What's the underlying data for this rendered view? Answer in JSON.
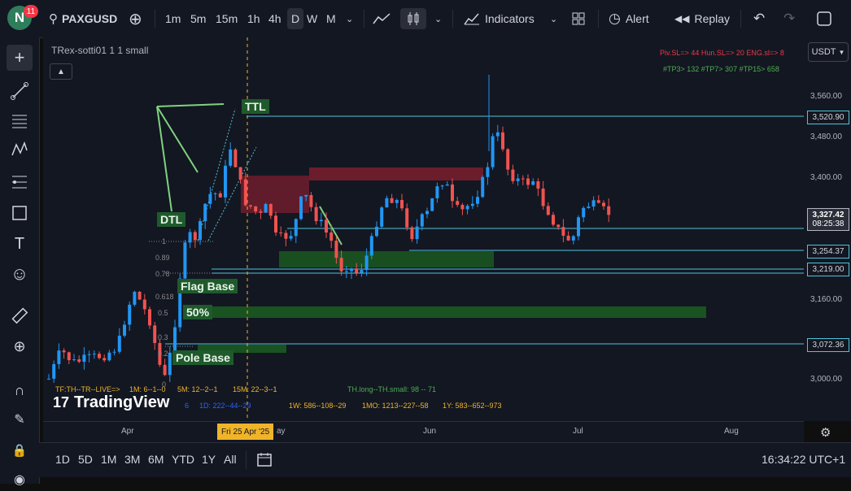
{
  "topbar": {
    "avatar_letter": "N",
    "notification_count": "11",
    "symbol": "PAXGUSD",
    "timeframes": [
      "1m",
      "5m",
      "15m",
      "1h",
      "4h",
      "D",
      "W",
      "M"
    ],
    "active_timeframe": "D",
    "indicators_label": "Indicators",
    "alert_label": "Alert",
    "replay_label": "Replay"
  },
  "chart": {
    "indicator_title": "TRex-sotti01 1 1 small",
    "currency": "USDT",
    "top_right_red": "Piv.SL=> 44  Hun.SL=> 20  ENG.sl=> 8",
    "top_right_green": "#TP3> 132  #TP7> 307  #TP15> 658",
    "labels": {
      "ttl": "TTL",
      "dtl": "DTL",
      "flag_base": "Flag Base",
      "fifty": "50%",
      "pole_base": "Pole Base"
    },
    "fib_levels": [
      "1",
      "0.89",
      "0.78",
      "0.618",
      "0.5",
      "0.3",
      "0.2",
      "0"
    ],
    "bottom_info": {
      "tf_line": "TF:TH--TR--LIVE=>",
      "m1": "1M: 6--1--0",
      "m5": "5M: 12--2--1",
      "m15": "15M: 22--3--1",
      "th": "TH.long--TH.small: 98 -- 71",
      "h1": "1D: 222--44--29",
      "w1": "1W: 586--108--29",
      "mo": "1MO: 1213--227--58",
      "y1": "1Y: 583--652--973",
      "six": "6"
    },
    "watermark": "TradingView"
  },
  "price_scale": {
    "ticks": [
      "3,560.00",
      "3,480.00",
      "3,400.00",
      "3,160.00",
      "3,000.00"
    ],
    "labels": {
      "p3520": "3,520.90",
      "current": "3,327.42",
      "countdown": "08:25:38",
      "p3254": "3,254.37",
      "p3219": "3,219.00",
      "p3072": "3,072.36"
    }
  },
  "time_axis": {
    "ticks": [
      "Apr",
      "Jun",
      "Jul",
      "Aug"
    ],
    "cursor_label": "Fri 25 Apr '25",
    "partial_may": "ay"
  },
  "bottombar": {
    "ranges": [
      "1D",
      "5D",
      "1M",
      "3M",
      "6M",
      "YTD",
      "1Y",
      "All"
    ],
    "clock": "16:34:22 UTC+1"
  },
  "colors": {
    "bull": "#2196f3",
    "bear": "#ef5350",
    "hline": "#4fc3d9",
    "green_zone": "#1b5e20",
    "red_zone": "#7b1f2e"
  }
}
